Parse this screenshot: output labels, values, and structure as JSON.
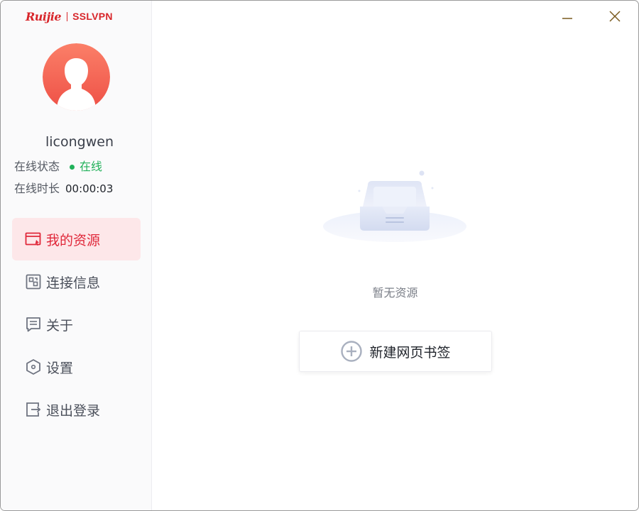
{
  "logo": {
    "brand": "Ruijie",
    "product": "SSLVPN"
  },
  "user": {
    "username": "licongwen",
    "status_label": "在线状态",
    "status_value": "在线",
    "duration_label": "在线时长",
    "duration_value": "00:00:03"
  },
  "nav": [
    {
      "label": "我的资源",
      "icon": "my-resources-icon",
      "active": true
    },
    {
      "label": "连接信息",
      "icon": "connection-info-icon",
      "active": false
    },
    {
      "label": "关于",
      "icon": "about-icon",
      "active": false
    },
    {
      "label": "设置",
      "icon": "settings-icon",
      "active": false
    },
    {
      "label": "退出登录",
      "icon": "logout-icon",
      "active": false
    }
  ],
  "main": {
    "empty_text": "暂无资源",
    "add_bookmark_label": "新建网页书签"
  },
  "colors": {
    "accent": "#e0283a",
    "brand_red": "#d8262b",
    "online_green": "#21b15a",
    "active_bg": "#fde7e9"
  }
}
